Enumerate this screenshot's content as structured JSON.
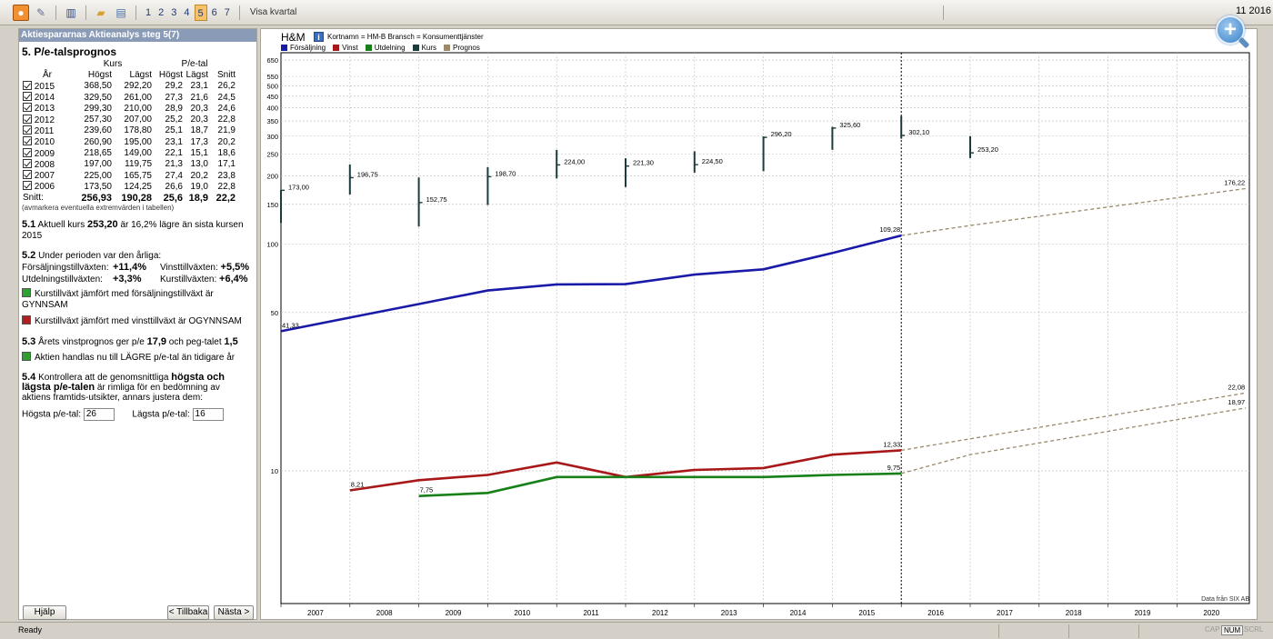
{
  "toolbar": {
    "icons": [
      "app-icon",
      "wrench-icon",
      "chart-icon",
      "folder-open-icon",
      "print-preview-icon"
    ],
    "steps": [
      "1",
      "2",
      "3",
      "4",
      "5",
      "6",
      "7"
    ],
    "active_step": "5",
    "show_quarter": "Visa kvartal",
    "date": "11 2016"
  },
  "left": {
    "header": "Aktiespararnas Aktieanalys steg 5(7)",
    "title": "5. P/e-talsprognos",
    "group_kurs": "Kurs",
    "group_pe": "P/e-tal",
    "columns": [
      "År",
      "Högst",
      "Lägst",
      "Högst",
      "Lägst",
      "Snitt"
    ],
    "rows": [
      {
        "year": "2015",
        "hi": "368,50",
        "lo": "292,20",
        "pehi": "29,2",
        "pelo": "23,1",
        "snitt": "26,2"
      },
      {
        "year": "2014",
        "hi": "329,50",
        "lo": "261,00",
        "pehi": "27,3",
        "pelo": "21,6",
        "snitt": "24,5"
      },
      {
        "year": "2013",
        "hi": "299,30",
        "lo": "210,00",
        "pehi": "28,9",
        "pelo": "20,3",
        "snitt": "24,6"
      },
      {
        "year": "2012",
        "hi": "257,30",
        "lo": "207,00",
        "pehi": "25,2",
        "pelo": "20,3",
        "snitt": "22,8"
      },
      {
        "year": "2011",
        "hi": "239,60",
        "lo": "178,80",
        "pehi": "25,1",
        "pelo": "18,7",
        "snitt": "21,9"
      },
      {
        "year": "2010",
        "hi": "260,90",
        "lo": "195,00",
        "pehi": "23,1",
        "pelo": "17,3",
        "snitt": "20,2"
      },
      {
        "year": "2009",
        "hi": "218,65",
        "lo": "149,00",
        "pehi": "22,1",
        "pelo": "15,1",
        "snitt": "18,6"
      },
      {
        "year": "2008",
        "hi": "197,00",
        "lo": "119,75",
        "pehi": "21,3",
        "pelo": "13,0",
        "snitt": "17,1"
      },
      {
        "year": "2007",
        "hi": "225,00",
        "lo": "165,75",
        "pehi": "27,4",
        "pelo": "20,2",
        "snitt": "23,8"
      },
      {
        "year": "2006",
        "hi": "173,50",
        "lo": "124,25",
        "pehi": "26,6",
        "pelo": "19,0",
        "snitt": "22,8"
      }
    ],
    "snitt_label": "Snitt:",
    "snitt": {
      "hi": "256,93",
      "lo": "190,28",
      "pehi": "25,6",
      "pelo": "18,9",
      "snitt": "22,2"
    },
    "note": "(avmarkera eventuella extremvärden i tabellen)",
    "s51_num": "5.1",
    "s51_a": "Aktuell kurs",
    "s51_price": "253,20",
    "s51_b": "är 16,2% lägre än sista kursen 2015",
    "s52_num": "5.2",
    "s52_title": "Under perioden var den årliga:",
    "sales_growth_label": "Försäljningstillväxten:",
    "sales_growth": "+11,4%",
    "profit_growth_label": "Vinsttillväxten:",
    "profit_growth": "+5,5%",
    "div_growth_label": "Utdelningstillväxten:",
    "div_growth": "+3,3%",
    "price_growth_label": "Kurstillväxten:",
    "price_growth": "+6,4%",
    "cmp1": "Kurstillväxt jämfört med försäljningstillväxt är GYNNSAM",
    "cmp2": "Kurstillväxt jämfört med vinsttillväxt är OGYNNSAM",
    "s53_num": "5.3",
    "s53_a": "Årets vinstprognos ger p/e",
    "s53_pe": "17,9",
    "s53_b": "och peg-talet",
    "s53_peg": "1,5",
    "s53_note": "Aktien handlas nu till LÄGRE p/e-tal än tidigare år",
    "s54_num": "5.4",
    "s54_a": "Kontrollera att de genomsnittliga",
    "s54_bold": "högsta och lägsta p/e-talen",
    "s54_b": "är rimliga för en bedömning av aktiens framtids-utsikter, annars justera dem:",
    "hi_pe_label": "Högsta p/e-tal:",
    "hi_pe_value": "26",
    "lo_pe_label": "Lägsta p/e-tal:",
    "lo_pe_value": "16",
    "help": "Hjälp",
    "back": "< Tillbaka",
    "next": "Nästa >"
  },
  "chart_header": {
    "title": "H&M",
    "info_icon": "info-icon",
    "subtitle": "Kortnamn = HM-B  Bransch = Konsumenttjänster",
    "legend": [
      {
        "label": "Försäljning",
        "color": "#1a1aa8"
      },
      {
        "label": "Vinst",
        "color": "#a81818"
      },
      {
        "label": "Utdelning",
        "color": "#188018"
      },
      {
        "label": "Kurs",
        "color": "#1c3c3c"
      },
      {
        "label": "Prognos",
        "color": "#9a8a6a"
      }
    ],
    "source": "Data från SIX AB"
  },
  "chart_data": {
    "type": "line",
    "y_scale": "log",
    "ylim": [
      2.6,
      700
    ],
    "y_ticks": [
      10,
      50,
      100,
      150,
      200,
      250,
      300,
      350,
      400,
      450,
      500,
      550,
      650
    ],
    "x_labels": [
      "2007",
      "2008",
      "2009",
      "2010",
      "2011",
      "2012",
      "2013",
      "2014",
      "2015",
      "2016",
      "2017",
      "2018",
      "2019",
      "2020"
    ],
    "series": [
      {
        "name": "Försäljning",
        "color": "#1a1aa8",
        "x": [
          2006.5,
          2007.5,
          2008.5,
          2009.5,
          2010.5,
          2011.5,
          2012.5,
          2013.5,
          2014.5,
          2015.5
        ],
        "y": [
          41.33,
          47.5,
          54.5,
          62.5,
          66.5,
          66.7,
          73.5,
          77.5,
          91.5,
          109.28
        ],
        "labels": {
          "0": "41,33",
          "9": "109,28"
        }
      },
      {
        "name": "Vinst",
        "color": "#a81818",
        "x": [
          2007.5,
          2008.5,
          2009.5,
          2010.5,
          2011.5,
          2012.5,
          2013.5,
          2014.5,
          2015.5
        ],
        "y": [
          8.21,
          9.1,
          9.6,
          10.9,
          9.4,
          10.1,
          10.3,
          11.8,
          12.33
        ],
        "labels": {
          "0": "8,21",
          "8": "12,33"
        }
      },
      {
        "name": "Utdelning",
        "color": "#188018",
        "x": [
          2008.5,
          2009.5,
          2010.5,
          2011.5,
          2012.5,
          2013.5,
          2014.5,
          2015.5
        ],
        "y": [
          7.75,
          8.0,
          9.4,
          9.4,
          9.4,
          9.4,
          9.6,
          9.75
        ],
        "labels": {
          "0": "7,75",
          "7": "9,75"
        }
      },
      {
        "name": "Prognos",
        "color": "#9a8a6a",
        "dashed": true,
        "x": [
          2015.5,
          2016.5,
          2020.5
        ],
        "y": [
          109.28,
          121.0,
          176.22
        ],
        "labels": {
          "2": "176,22"
        }
      },
      {
        "name": "Prognos",
        "color": "#9a8a6a",
        "dashed": true,
        "x": [
          2015.5,
          2020.5
        ],
        "y": [
          12.33,
          22.08
        ],
        "labels": {
          "1": "22,08"
        }
      },
      {
        "name": "Prognos",
        "color": "#9a8a6a",
        "dashed": true,
        "x": [
          2015.5,
          2016.5,
          2020.5
        ],
        "y": [
          9.75,
          11.8,
          18.97
        ],
        "labels": {
          "2": "18,97"
        }
      }
    ],
    "price_ranges": [
      {
        "x": 2006.5,
        "hi": 173.5,
        "lo": 124.25,
        "close": 173.0,
        "label": "173,00"
      },
      {
        "x": 2007.5,
        "hi": 225.0,
        "lo": 165.75,
        "close": 196.75,
        "label": "196,75"
      },
      {
        "x": 2008.5,
        "hi": 197.0,
        "lo": 119.75,
        "close": 152.75,
        "label": "152,75"
      },
      {
        "x": 2009.5,
        "hi": 218.65,
        "lo": 149.0,
        "close": 198.7,
        "label": "198,70"
      },
      {
        "x": 2010.5,
        "hi": 260.9,
        "lo": 195.0,
        "close": 224.0,
        "label": "224,00"
      },
      {
        "x": 2011.5,
        "hi": 239.6,
        "lo": 178.8,
        "close": 221.3,
        "label": "221,30"
      },
      {
        "x": 2012.5,
        "hi": 257.3,
        "lo": 207.0,
        "close": 224.5,
        "label": "224,50"
      },
      {
        "x": 2013.5,
        "hi": 299.3,
        "lo": 210.0,
        "close": 296.2,
        "label": "296,20"
      },
      {
        "x": 2014.5,
        "hi": 329.5,
        "lo": 261.0,
        "close": 325.6,
        "label": "325,60"
      },
      {
        "x": 2015.5,
        "hi": 368.5,
        "lo": 292.2,
        "close": 302.1,
        "label": "302,10"
      },
      {
        "x": 2016.5,
        "hi": 300.0,
        "lo": 240.0,
        "close": 253.2,
        "label": "253,20"
      }
    ],
    "current_marker_year": "2016",
    "grid": true
  },
  "status": {
    "text": "Ready",
    "indicators": [
      {
        "label": "CAP",
        "on": false
      },
      {
        "label": "NUM",
        "on": true
      },
      {
        "label": "SCRL",
        "on": false
      }
    ]
  }
}
